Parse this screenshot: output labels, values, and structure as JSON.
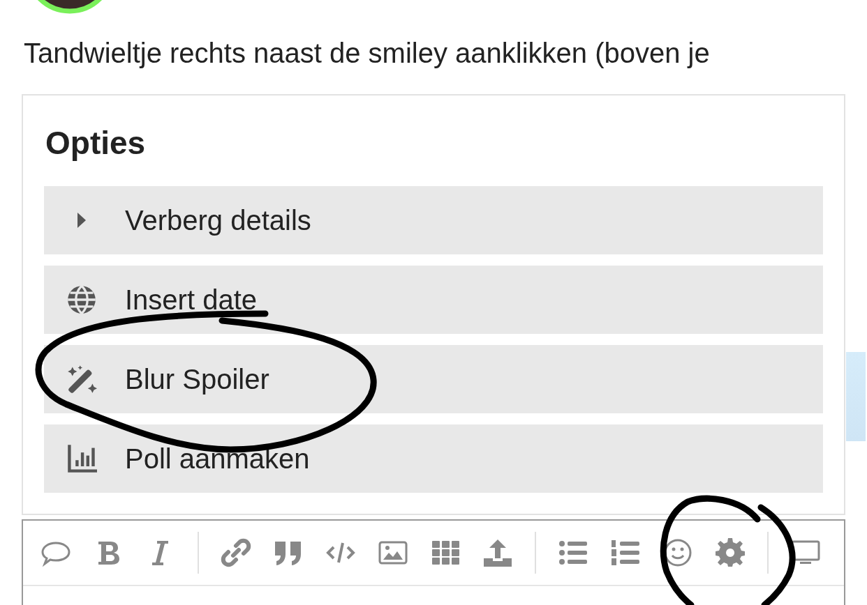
{
  "post": {
    "lines": [
      "Tandwieltje rechts naast de smiley aanklikken (boven je"
    ]
  },
  "options_popup": {
    "title": "Opties",
    "items": [
      {
        "label": "Verberg details"
      },
      {
        "label": "Insert date"
      },
      {
        "label": "Blur Spoiler"
      },
      {
        "label": "Poll aanmaken"
      }
    ]
  }
}
